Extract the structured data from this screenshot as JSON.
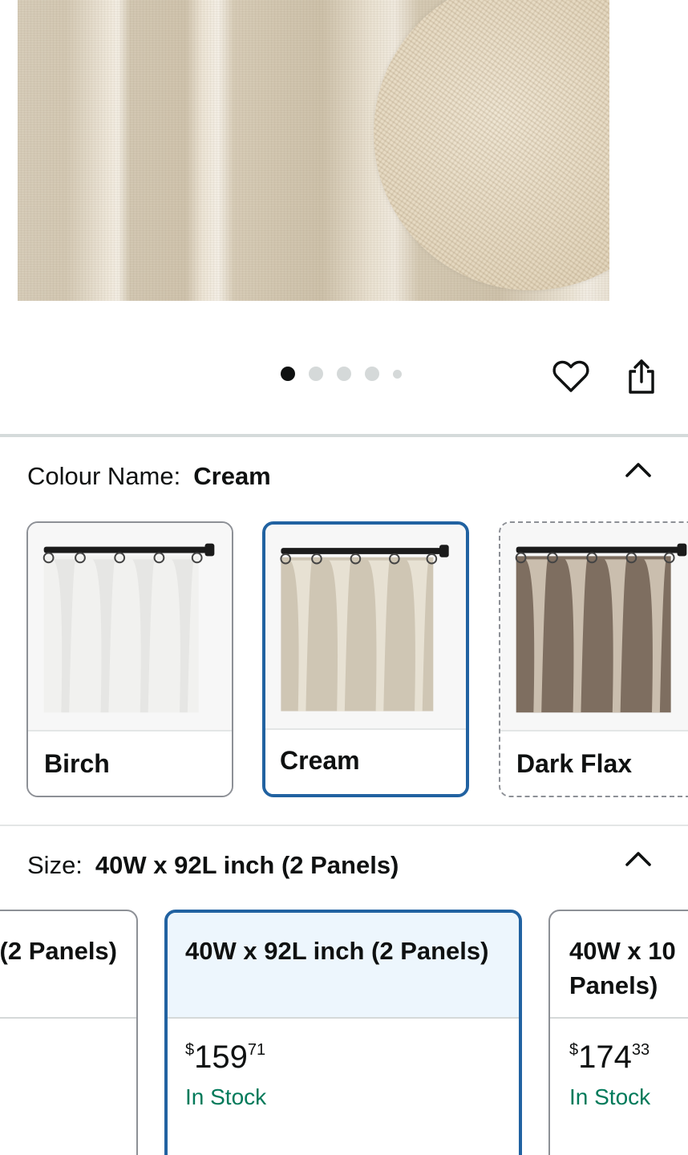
{
  "gallery": {
    "dots": [
      "active",
      "normal",
      "normal",
      "normal",
      "small"
    ],
    "icons": {
      "wishlist": "heart-icon",
      "share": "share-icon"
    }
  },
  "colour": {
    "label": "Colour Name:",
    "selected": "Cream",
    "collapse_icon": "chevron-up-icon",
    "options": [
      {
        "name": "Birch",
        "state": "available",
        "curtain_color": "#f1f1ef",
        "fold_color": "#e4e4e2",
        "backdrop": "#dcdcdc"
      },
      {
        "name": "Cream",
        "state": "selected",
        "curtain_color": "#cfc6b4",
        "fold_color": "#e9e3d6",
        "backdrop": "#d6cdbb"
      },
      {
        "name": "Dark Flax",
        "state": "unavailable",
        "curtain_color": "#7e6e60",
        "fold_color": "#d3c6b7",
        "backdrop": "#8a7a6b"
      }
    ]
  },
  "size": {
    "label": "Size:",
    "selected": "40W x 92L inch (2 Panels)",
    "collapse_icon": "chevron-up-icon",
    "options": [
      {
        "title": "(2 Panels)",
        "price_symbol": "",
        "price_whole": "",
        "price_fraction": "",
        "stock": ""
      },
      {
        "title": "40W x 92L inch (2 Panels)",
        "price_symbol": "$",
        "price_whole": "159",
        "price_fraction": "71",
        "stock": "In Stock"
      },
      {
        "title_line1": "40W x 10",
        "title_line2": "Panels)",
        "price_symbol": "$",
        "price_whole": "174",
        "price_fraction": "33",
        "stock": "In Stock"
      }
    ]
  },
  "colors": {
    "accent_selected": "#2162a1",
    "in_stock": "#007a5a",
    "selected_bg": "#edf6fd"
  }
}
